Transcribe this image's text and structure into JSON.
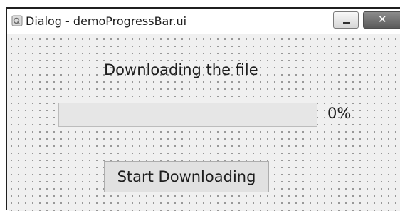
{
  "window": {
    "title": "Dialog - demoProgressBar.ui",
    "minimize_icon": "minimize-icon",
    "close_icon": "close-icon",
    "close_glyph": "✕"
  },
  "dialog": {
    "label": "Downloading the file",
    "progress": {
      "value": 0,
      "text": "0%"
    },
    "start_button_label": "Start Downloading"
  },
  "colors": {
    "progress_fill": "#06b025",
    "progress_track": "#e6e6e6",
    "dialog_background": "#f0f0f0"
  }
}
